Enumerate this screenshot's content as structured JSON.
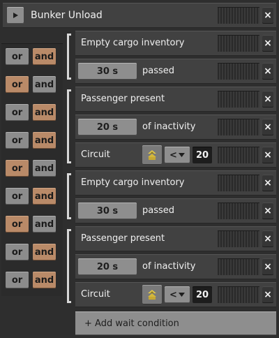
{
  "station": {
    "name": "Bunker Unload",
    "close_symbol": "×"
  },
  "logic_rows": [
    {
      "or": "or",
      "and": "and",
      "active": "and"
    },
    {
      "or": "or",
      "and": "and",
      "active": "or"
    },
    {
      "or": "or",
      "and": "and",
      "active": "and"
    },
    {
      "or": "or",
      "and": "and",
      "active": "and"
    },
    {
      "or": "or",
      "and": "and",
      "active": "or"
    },
    {
      "or": "or",
      "and": "and",
      "active": "and"
    },
    {
      "or": "or",
      "and": "and",
      "active": "or"
    },
    {
      "or": "or",
      "and": "and",
      "active": "and"
    },
    {
      "or": "or",
      "and": "and",
      "active": "and"
    }
  ],
  "conditions": [
    {
      "type": "label",
      "text": "Empty cargo inventory",
      "close": "×"
    },
    {
      "type": "time",
      "value": "30 s",
      "text": "passed",
      "close": "×"
    },
    {
      "type": "label",
      "text": "Passenger present",
      "close": "×"
    },
    {
      "type": "time",
      "value": "20 s",
      "text": "of inactivity",
      "close": "×"
    },
    {
      "type": "circuit",
      "text": "Circuit",
      "comparator": "<",
      "number": "20",
      "signal_icon": "signal-icon",
      "close": "×"
    },
    {
      "type": "label",
      "text": "Empty cargo inventory",
      "close": "×"
    },
    {
      "type": "time",
      "value": "30 s",
      "text": "passed",
      "close": "×"
    },
    {
      "type": "label",
      "text": "Passenger present",
      "close": "×"
    },
    {
      "type": "time",
      "value": "20 s",
      "text": "of inactivity",
      "close": "×"
    },
    {
      "type": "circuit",
      "text": "Circuit",
      "comparator": "<",
      "number": "20",
      "signal_icon": "signal-icon",
      "close": "×"
    }
  ],
  "add_condition": "+ Add wait condition",
  "colors": {
    "background": "#2e2e2e",
    "row": "#414141",
    "active_logic": "#b98a68",
    "inactive_logic": "#8c8c8c"
  }
}
